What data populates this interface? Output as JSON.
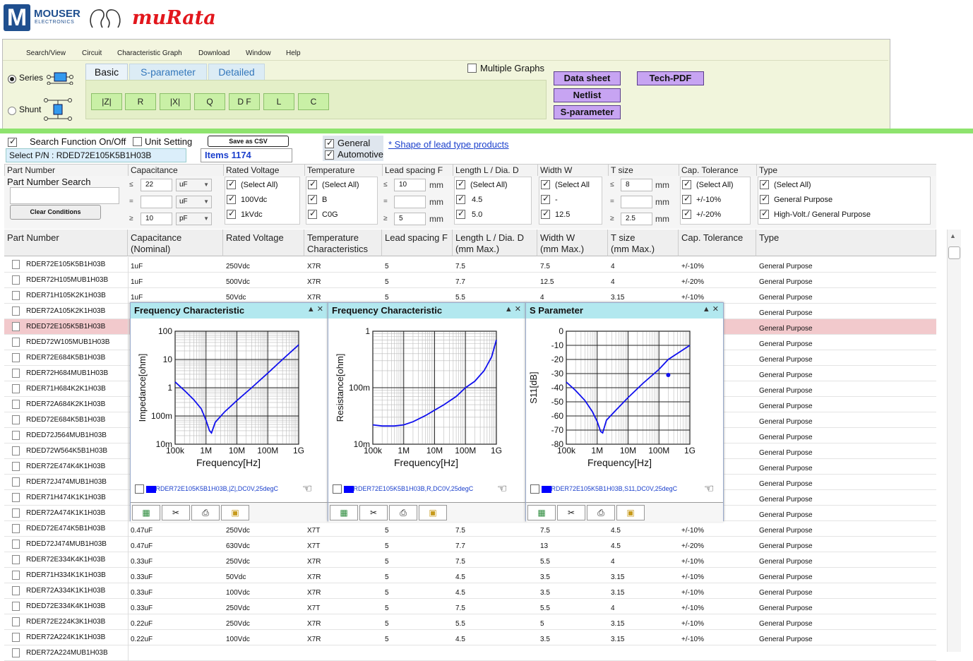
{
  "logos": {
    "mouser_letter": "M",
    "mouser_name": "MOUSER",
    "mouser_sub": "ELECTRONICS",
    "murata": "muRata"
  },
  "menu": [
    "Search/View",
    "Circuit",
    "Characteristic Graph",
    "Download",
    "Window",
    "Help"
  ],
  "circuit": {
    "series_label": "Series",
    "shunt_label": "Shunt",
    "selected": "Series"
  },
  "tabs": [
    {
      "label": "Basic",
      "active": true
    },
    {
      "label": "S-parameter"
    },
    {
      "label": "Detailed"
    }
  ],
  "graph_buttons": [
    "|Z|",
    "R",
    "|X|",
    "Q",
    "D F",
    "L",
    "C"
  ],
  "multiple_graphs": "Multiple Graphs",
  "action_buttons": {
    "datasheet": "Data sheet",
    "techpdf": "Tech-PDF",
    "netlist": "Netlist",
    "sparam": "S-parameter"
  },
  "search_bar": {
    "search_toggle": "Search Function On/Off",
    "unit_setting": "Unit Setting",
    "save_csv": "Save as CSV",
    "selected_pn": "Select P/N : RDED72E105K5B1H03B",
    "items": "Items 1174",
    "general": "General",
    "automotive": "Automotive",
    "lead_link": "* Shape of lead type products"
  },
  "filters": {
    "partnumber": {
      "header": "Part Number",
      "search_label": "Part Number Search",
      "clear": "Clear Conditions"
    },
    "capacitance": {
      "header": "Capacitance",
      "min": "22",
      "min_unit": "uF",
      "eq": "",
      "eq_unit": "uF",
      "max": "10",
      "max_unit": "pF"
    },
    "voltage": {
      "header": "Rated Voltage",
      "items": [
        "(Select All)",
        "100Vdc",
        "1kVdc"
      ]
    },
    "temperature": {
      "header": "Temperature",
      "items": [
        "(Select All)",
        "B",
        "C0G"
      ]
    },
    "lead": {
      "header": "Lead spacing F",
      "min": "10",
      "eq": "",
      "max": "5",
      "unit": "mm"
    },
    "length": {
      "header": "Length L / Dia. D",
      "items": [
        "(Select All)",
        "4.5",
        "5.0"
      ]
    },
    "width": {
      "header": "Width W",
      "items": [
        "(Select All",
        "-",
        "12.5"
      ]
    },
    "tsize": {
      "header": "T size",
      "min": "8",
      "eq": "",
      "max": "2.5",
      "unit": "mm"
    },
    "tolerance": {
      "header": "Cap. Tolerance",
      "items": [
        "(Select All)",
        "+/-10%",
        "+/-20%"
      ]
    },
    "type": {
      "header": "Type",
      "items": [
        "(Select All)",
        "General Purpose",
        "High-Volt./ General Purpose"
      ]
    }
  },
  "columns": [
    "Part Number",
    "Capacitance\n(Nominal)",
    "Rated Voltage",
    "Temperature\nCharacteristics",
    "Lead spacing F",
    "Length L / Dia. D\n(mm Max.)",
    "Width W\n(mm Max.)",
    "T size\n(mm Max.)",
    "Cap. Tolerance",
    "Type"
  ],
  "rows": [
    [
      "RDER72E105K5B1H03B",
      "1uF",
      "250Vdc",
      "X7R",
      "5",
      "7.5",
      "7.5",
      "4",
      "+/-10%",
      "General Purpose"
    ],
    [
      "RDER72H105MUB1H03B",
      "1uF",
      "500Vdc",
      "X7R",
      "5",
      "7.7",
      "12.5",
      "4",
      "+/-20%",
      "General Purpose"
    ],
    [
      "RDER71H105K2K1H03B",
      "1uF",
      "50Vdc",
      "X7R",
      "5",
      "5.5",
      "4",
      "3.15",
      "+/-10%",
      "General Purpose"
    ],
    [
      "RDER72A105K2K1H03B",
      "",
      "",
      "",
      "",
      "",
      "",
      "",
      "",
      "General Purpose"
    ],
    [
      "RDED72E105K5B1H03B",
      "",
      "",
      "",
      "",
      "",
      "",
      "",
      "",
      "General Purpose"
    ],
    [
      "RDED72W105MUB1H03B",
      "",
      "",
      "",
      "",
      "",
      "",
      "",
      "",
      "General Purpose"
    ],
    [
      "RDER72E684K5B1H03B",
      "",
      "",
      "",
      "",
      "",
      "",
      "",
      "",
      "General Purpose"
    ],
    [
      "RDER72H684MUB1H03B",
      "",
      "",
      "",
      "",
      "",
      "",
      "",
      "",
      "General Purpose"
    ],
    [
      "RDER71H684K2K1H03B",
      "",
      "",
      "",
      "",
      "",
      "",
      "",
      "",
      "General Purpose"
    ],
    [
      "RDER72A684K2K1H03B",
      "",
      "",
      "",
      "",
      "",
      "",
      "",
      "",
      "General Purpose"
    ],
    [
      "RDED72E684K5B1H03B",
      "",
      "",
      "",
      "",
      "",
      "",
      "",
      "",
      "General Purpose"
    ],
    [
      "RDED72J564MUB1H03B",
      "",
      "",
      "",
      "",
      "",
      "",
      "",
      "",
      "General Purpose"
    ],
    [
      "RDED72W564K5B1H03B",
      "",
      "",
      "",
      "",
      "",
      "",
      "",
      "",
      "General Purpose"
    ],
    [
      "RDER72E474K4K1H03B",
      "",
      "",
      "",
      "",
      "",
      "",
      "",
      "",
      "General Purpose"
    ],
    [
      "RDER72J474MUB1H03B",
      "",
      "",
      "",
      "",
      "",
      "",
      "",
      "",
      "General Purpose"
    ],
    [
      "RDER71H474K1K1H03B",
      "",
      "",
      "",
      "",
      "",
      "",
      "",
      "",
      "General Purpose"
    ],
    [
      "RDER72A474K1K1H03B",
      "",
      "",
      "",
      "",
      "",
      "",
      "",
      "",
      "General Purpose"
    ],
    [
      "RDED72E474K5B1H03B",
      "0.47uF",
      "250Vdc",
      "X7T",
      "5",
      "7.5",
      "7.5",
      "4.5",
      "+/-10%",
      "General Purpose"
    ],
    [
      "RDED72J474MUB1H03B",
      "0.47uF",
      "630Vdc",
      "X7T",
      "5",
      "7.7",
      "13",
      "4.5",
      "+/-20%",
      "General Purpose"
    ],
    [
      "RDER72E334K4K1H03B",
      "0.33uF",
      "250Vdc",
      "X7R",
      "5",
      "7.5",
      "5.5",
      "4",
      "+/-10%",
      "General Purpose"
    ],
    [
      "RDER71H334K1K1H03B",
      "0.33uF",
      "50Vdc",
      "X7R",
      "5",
      "4.5",
      "3.5",
      "3.15",
      "+/-10%",
      "General Purpose"
    ],
    [
      "RDER72A334K1K1H03B",
      "0.33uF",
      "100Vdc",
      "X7R",
      "5",
      "4.5",
      "3.5",
      "3.15",
      "+/-10%",
      "General Purpose"
    ],
    [
      "RDED72E334K4K1H03B",
      "0.33uF",
      "250Vdc",
      "X7T",
      "5",
      "7.5",
      "5.5",
      "4",
      "+/-10%",
      "General Purpose"
    ],
    [
      "RDER72E224K3K1H03B",
      "0.22uF",
      "250Vdc",
      "X7R",
      "5",
      "5.5",
      "5",
      "3.15",
      "+/-10%",
      "General Purpose"
    ],
    [
      "RDER72A224K1K1H03B",
      "0.22uF",
      "100Vdc",
      "X7R",
      "5",
      "4.5",
      "3.5",
      "3.15",
      "+/-10%",
      "General Purpose"
    ],
    [
      "RDER72A224MUB1H03B",
      "",
      "",
      "",
      "",
      "",
      "",
      "",
      "",
      ""
    ]
  ],
  "selected_row": 4,
  "chart_data": [
    {
      "type": "line",
      "title": "Frequency Characteristic",
      "xlabel": "Frequency[Hz]",
      "ylabel": "Impedance[ohm]",
      "xscale": "log",
      "yscale": "log",
      "xlim": [
        100000,
        1000000000
      ],
      "ylim": [
        0.01,
        100
      ],
      "xticks": [
        "100k",
        "1M",
        "10M",
        "100M",
        "1G"
      ],
      "yticks": [
        "100",
        "10",
        "1",
        "100m",
        "10m"
      ],
      "series": [
        {
          "name": "RDER72E105K5B1H03B,|Z|,DC0V,25degC",
          "color": "#1010ee",
          "x": [
            100000,
            200000,
            400000,
            700000,
            1000000,
            1300000,
            1500000,
            2000000,
            4000000,
            10000000,
            30000000,
            100000000,
            300000000,
            1000000000
          ],
          "y": [
            1.6,
            0.8,
            0.38,
            0.18,
            0.07,
            0.03,
            0.025,
            0.06,
            0.14,
            0.35,
            1.0,
            3.3,
            10,
            33
          ]
        }
      ]
    },
    {
      "type": "line",
      "title": "Frequency Characteristic",
      "xlabel": "Frequency[Hz]",
      "ylabel": "Resistance[ohm]",
      "xscale": "log",
      "yscale": "log",
      "xlim": [
        100000,
        1000000000
      ],
      "ylim": [
        0.01,
        1
      ],
      "yticks": [
        "1",
        "100m",
        "10m"
      ],
      "xticks": [
        "100k",
        "1M",
        "10M",
        "100M",
        "1G"
      ],
      "series": [
        {
          "name": "RDER72E105K5B1H03B,R,DC0V,25degC",
          "color": "#1010ee",
          "x": [
            100000,
            200000,
            500000,
            1000000,
            2000000,
            5000000,
            10000000,
            20000000,
            50000000,
            100000000,
            200000000,
            400000000,
            700000000,
            1000000000
          ],
          "y": [
            0.022,
            0.021,
            0.021,
            0.022,
            0.025,
            0.032,
            0.04,
            0.05,
            0.07,
            0.1,
            0.13,
            0.2,
            0.35,
            0.7
          ]
        }
      ]
    },
    {
      "type": "line",
      "title": "S Parameter",
      "xlabel": "Frequency[Hz]",
      "ylabel": "S11[dB]",
      "xscale": "log",
      "xlim": [
        100000,
        1000000000
      ],
      "ylim": [
        -80,
        0
      ],
      "yticks": [
        "0",
        "-10",
        "-20",
        "-30",
        "-40",
        "-50",
        "-60",
        "-70",
        "-80"
      ],
      "xticks": [
        "100k",
        "1M",
        "10M",
        "100M",
        "1G"
      ],
      "series": [
        {
          "name": "RDER72E105K5B1H03B,S11,DC0V,25degC",
          "color": "#1010ee",
          "x": [
            100000,
            200000,
            400000,
            700000,
            1000000,
            1300000,
            1500000,
            2000000,
            4000000,
            10000000,
            30000000,
            100000000,
            200000000,
            1000000000
          ],
          "y": [
            -36,
            -42,
            -49,
            -57,
            -64,
            -71,
            -72,
            -63,
            -56,
            -47,
            -37,
            -27,
            -20,
            -10
          ]
        }
      ],
      "marker": {
        "x": 200000000,
        "y": -31
      }
    }
  ],
  "panel_tools": [
    "excel-icon",
    "scissors-icon",
    "print-icon",
    "image-icon"
  ]
}
